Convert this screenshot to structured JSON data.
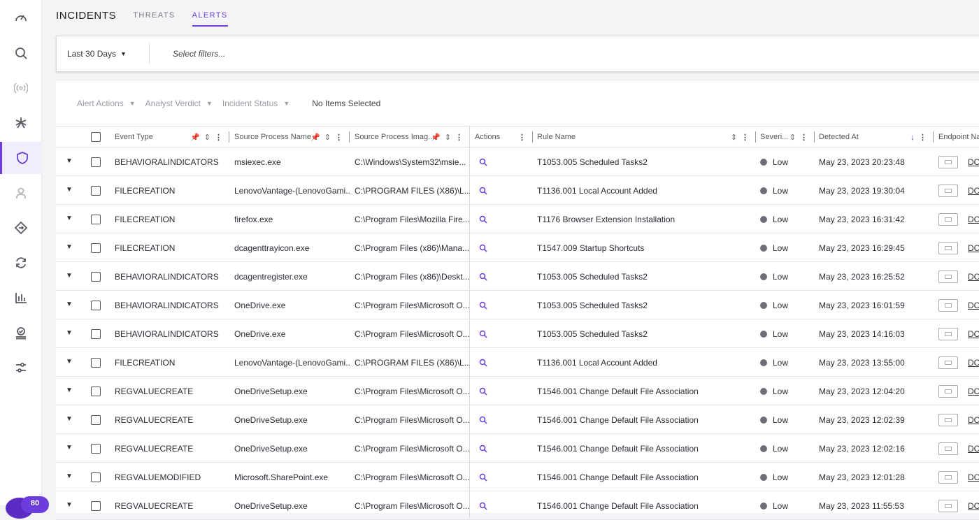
{
  "sidebar": {
    "icons": [
      "dashboard-icon",
      "search-icon",
      "radar-icon",
      "asterisk-icon",
      "shield-icon",
      "user-icon",
      "diamond-arrow-icon",
      "sync-icon",
      "bar-chart-icon",
      "user-check-icon",
      "sliders-icon"
    ],
    "active": "shield-icon",
    "badge": "80"
  },
  "tabs": {
    "incidents": "INCIDENTS",
    "threats": "THREATS",
    "alerts": "ALERTS",
    "active": "ALERTS"
  },
  "filterbar": {
    "date_range": "Last 30 Days",
    "filter_placeholder": "Select filters..."
  },
  "actionbar": {
    "alert_actions": "Alert Actions",
    "analyst_verdict": "Analyst Verdict",
    "incident_status": "Incident Status",
    "selection": "No Items Selected"
  },
  "columns": {
    "event_type": "Event Type",
    "source_process_name": "Source Process Name",
    "source_process_image": "Source Process Imag...",
    "actions": "Actions",
    "rule_name": "Rule Name",
    "severity": "Severi...",
    "detected_at": "Detected At",
    "endpoint_name": "Endpoint Na"
  },
  "rows": [
    {
      "event_type": "BEHAVIORALINDICATORS",
      "process": "msiexec.exe",
      "image": "C:\\Windows\\System32\\msie...",
      "rule": "T1053.005 Scheduled Tasks2",
      "severity": "Low",
      "detected": "May 23, 2023 20:23:48",
      "endpoint": "DC"
    },
    {
      "event_type": "FILECREATION",
      "process": "LenovoVantage-(LenovoGami...",
      "image": "C:\\PROGRAM FILES (X86)\\L...",
      "rule": "T1136.001 Local Account Added",
      "severity": "Low",
      "detected": "May 23, 2023 19:30:04",
      "endpoint": "DC"
    },
    {
      "event_type": "FILECREATION",
      "process": "firefox.exe",
      "image": "C:\\Program Files\\Mozilla Fire...",
      "rule": "T1176 Browser Extension Installation",
      "severity": "Low",
      "detected": "May 23, 2023 16:31:42",
      "endpoint": "DC"
    },
    {
      "event_type": "FILECREATION",
      "process": "dcagenttrayicon.exe",
      "image": "C:\\Program Files (x86)\\Mana...",
      "rule": "T1547.009 Startup Shortcuts",
      "severity": "Low",
      "detected": "May 23, 2023 16:29:45",
      "endpoint": "DC"
    },
    {
      "event_type": "BEHAVIORALINDICATORS",
      "process": "dcagentregister.exe",
      "image": "C:\\Program Files (x86)\\Deskt...",
      "rule": "T1053.005 Scheduled Tasks2",
      "severity": "Low",
      "detected": "May 23, 2023 16:25:52",
      "endpoint": "DC"
    },
    {
      "event_type": "BEHAVIORALINDICATORS",
      "process": "OneDrive.exe",
      "image": "C:\\Program Files\\Microsoft O...",
      "rule": "T1053.005 Scheduled Tasks2",
      "severity": "Low",
      "detected": "May 23, 2023 16:01:59",
      "endpoint": "DC"
    },
    {
      "event_type": "BEHAVIORALINDICATORS",
      "process": "OneDrive.exe",
      "image": "C:\\Program Files\\Microsoft O...",
      "rule": "T1053.005 Scheduled Tasks2",
      "severity": "Low",
      "detected": "May 23, 2023 14:16:03",
      "endpoint": "DC"
    },
    {
      "event_type": "FILECREATION",
      "process": "LenovoVantage-(LenovoGami...",
      "image": "C:\\PROGRAM FILES (X86)\\L...",
      "rule": "T1136.001 Local Account Added",
      "severity": "Low",
      "detected": "May 23, 2023 13:55:00",
      "endpoint": "DC"
    },
    {
      "event_type": "REGVALUECREATE",
      "process": "OneDriveSetup.exe",
      "image": "C:\\Program Files\\Microsoft O...",
      "rule": "T1546.001 Change Default File Association",
      "severity": "Low",
      "detected": "May 23, 2023 12:04:20",
      "endpoint": "DC"
    },
    {
      "event_type": "REGVALUECREATE",
      "process": "OneDriveSetup.exe",
      "image": "C:\\Program Files\\Microsoft O...",
      "rule": "T1546.001 Change Default File Association",
      "severity": "Low",
      "detected": "May 23, 2023 12:02:39",
      "endpoint": "DC"
    },
    {
      "event_type": "REGVALUECREATE",
      "process": "OneDriveSetup.exe",
      "image": "C:\\Program Files\\Microsoft O...",
      "rule": "T1546.001 Change Default File Association",
      "severity": "Low",
      "detected": "May 23, 2023 12:02:16",
      "endpoint": "DC"
    },
    {
      "event_type": "REGVALUEMODIFIED",
      "process": "Microsoft.SharePoint.exe",
      "image": "C:\\Program Files\\Microsoft O...",
      "rule": "T1546.001 Change Default File Association",
      "severity": "Low",
      "detected": "May 23, 2023 12:01:28",
      "endpoint": "DC"
    },
    {
      "event_type": "REGVALUECREATE",
      "process": "OneDriveSetup.exe",
      "image": "C:\\Program Files\\Microsoft O...",
      "rule": "T1546.001 Change Default File Association",
      "severity": "Low",
      "detected": "May 23, 2023 11:55:53",
      "endpoint": "DC"
    }
  ],
  "colors": {
    "accent": "#6c3cdc",
    "severity_low": "#6e6e78"
  }
}
